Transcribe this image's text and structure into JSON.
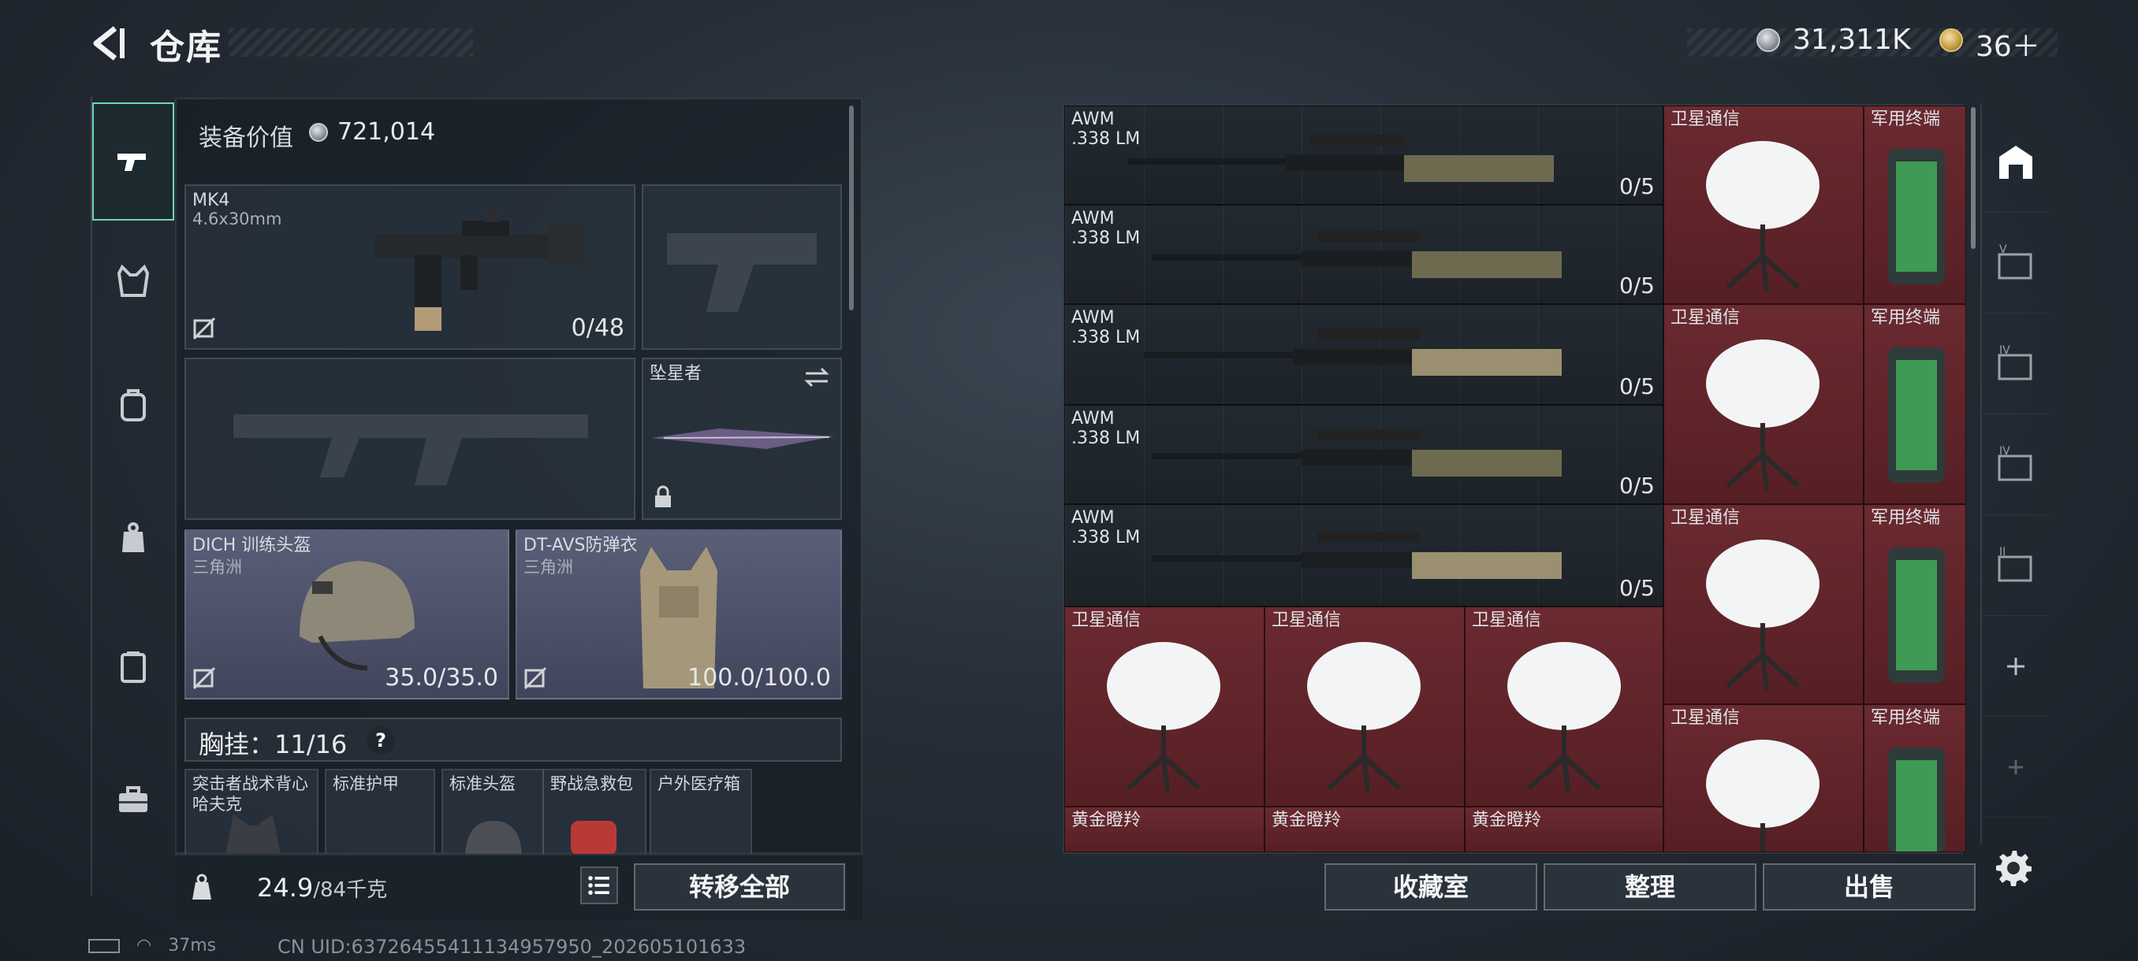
{
  "header": {
    "title": "仓库",
    "currency_silver": "31,311K",
    "currency_gold": "36＋"
  },
  "equipment": {
    "value_label": "装备价值",
    "value": "721,014",
    "primary": {
      "name": "MK4",
      "ammo": "4.6x30mm",
      "count": "0/48"
    },
    "melee": {
      "name": "坠星者"
    },
    "helmet": {
      "name": "DICH 训练头盔",
      "sub": "三角洲",
      "durability": "35.0/35.0"
    },
    "armor": {
      "name": "DT-AVS防弹衣",
      "sub": "三角洲",
      "durability": "100.0/100.0"
    },
    "chest_rig": {
      "label": "胸挂：11/16",
      "help": "?"
    },
    "rig_items": [
      {
        "name": "突击者战术背心 哈夫克"
      },
      {
        "name": "标准护甲"
      },
      {
        "name": "标准头盔"
      },
      {
        "name": "野战急救包"
      },
      {
        "name": "户外医疗箱"
      }
    ],
    "weight": "24.9",
    "weight_cap": "/84千克",
    "transfer_all": "转移全部"
  },
  "storage": {
    "rifles": [
      {
        "name": "AWM",
        "ammo": ".338 LM",
        "count": "0/5"
      },
      {
        "name": "AWM",
        "ammo": ".338 LM",
        "count": "0/5"
      },
      {
        "name": "AWM",
        "ammo": ".338 LM",
        "count": "0/5"
      },
      {
        "name": "AWM",
        "ammo": ".338 LM",
        "count": "0/5"
      },
      {
        "name": "AWM",
        "ammo": ".338 LM",
        "count": "0/5"
      }
    ],
    "sat_label": "卫星通信",
    "terminal_label": "军用终端",
    "gold_label": "黄金瞪羚"
  },
  "actions": {
    "collection": "收藏室",
    "sort": "整理",
    "sell": "出售"
  },
  "status": {
    "ping": "37ms",
    "uid": "CN UID:63726455411134957950_202605101633"
  },
  "colors": {
    "accent": "#6ed6b5",
    "rare_red": "#5f2328",
    "panel": "#1c242c"
  }
}
